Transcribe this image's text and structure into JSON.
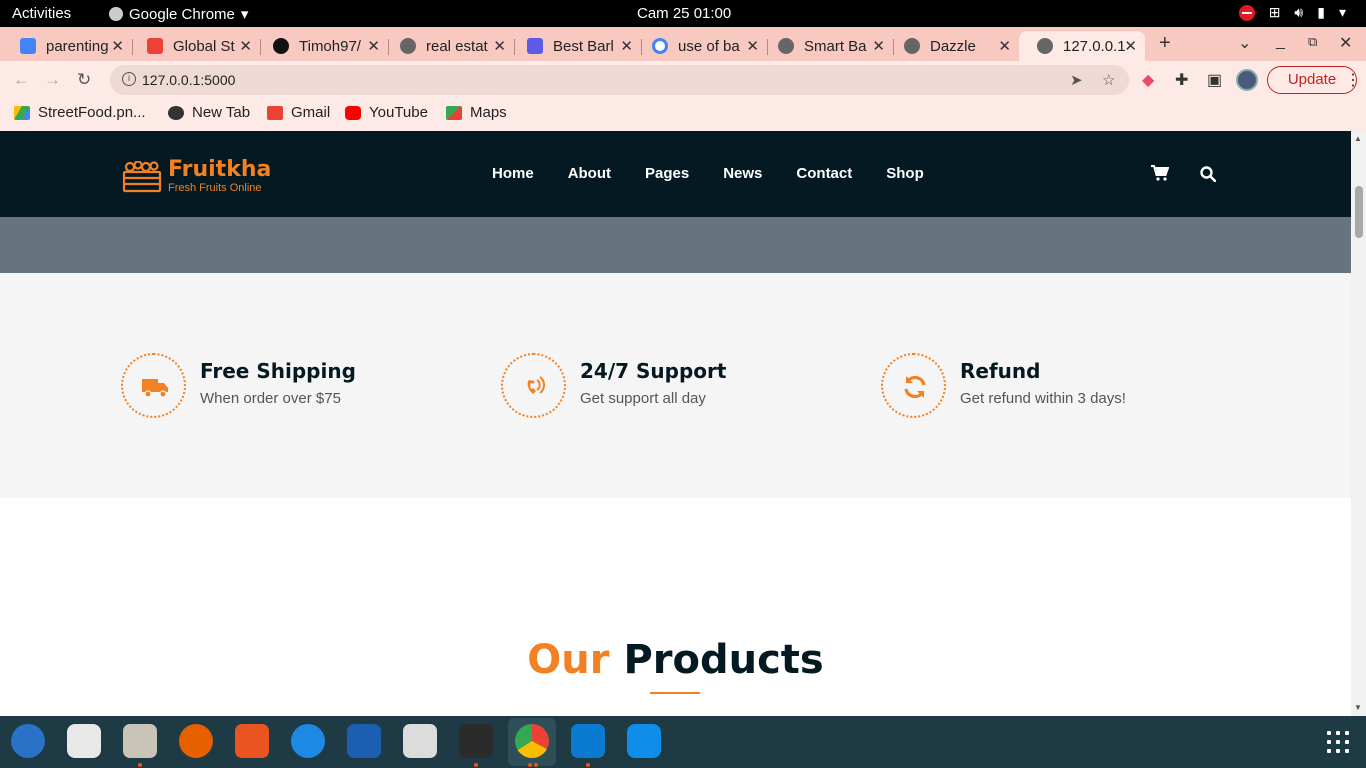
{
  "system": {
    "activities": "Activities",
    "app_name": "Google Chrome",
    "clock": "Cam 25  01:00"
  },
  "tabs": [
    {
      "title": "parenting",
      "icon": "google-docs-icon",
      "color": "#4285f4"
    },
    {
      "title": "Global St",
      "icon": "gmail-icon",
      "color": "#ea4335"
    },
    {
      "title": "Timoh97/",
      "icon": "github-icon",
      "color": "#111111"
    },
    {
      "title": "real estat",
      "icon": "globe-icon",
      "color": "#666666"
    },
    {
      "title": "Best Barl",
      "icon": "site-icon",
      "color": "#5b5be6"
    },
    {
      "title": "use of ba",
      "icon": "google-icon",
      "color": "#4285f4"
    },
    {
      "title": "Smart Ba",
      "icon": "globe-icon",
      "color": "#666666"
    },
    {
      "title": "Dazzle",
      "icon": "globe-icon",
      "color": "#666666"
    },
    {
      "title": "127.0.0.1",
      "icon": "globe-icon",
      "color": "#666666",
      "active": true
    }
  ],
  "toolbar": {
    "url": "127.0.0.1:5000",
    "update_label": "Update"
  },
  "bookmarks": [
    {
      "label": "StreetFood.pn...",
      "icon": "google-drive-icon"
    },
    {
      "label": "New Tab",
      "icon": "globe-icon"
    },
    {
      "label": "Gmail",
      "icon": "gmail-icon"
    },
    {
      "label": "YouTube",
      "icon": "youtube-icon"
    },
    {
      "label": "Maps",
      "icon": "maps-icon"
    }
  ],
  "site": {
    "logo_name": "Fruitkha",
    "logo_tagline": "Fresh Fruits Online",
    "menu": [
      "Home",
      "About",
      "Pages",
      "News",
      "Contact",
      "Shop"
    ],
    "features": [
      {
        "title": "Free Shipping",
        "desc": "When order over $75",
        "icon": "truck-icon"
      },
      {
        "title": "24/7 Support",
        "desc": "Get support all day",
        "icon": "phone-volume-icon"
      },
      {
        "title": "Refund",
        "desc": "Get refund within 3 days!",
        "icon": "refresh-icon"
      }
    ],
    "products_heading_accent": "Our",
    "products_heading_rest": "Products"
  },
  "colors": {
    "brand_orange": "#f28123",
    "header_dark": "#051922",
    "hero_strip": "#65747e",
    "tab_strip": "#f8c9c0"
  }
}
